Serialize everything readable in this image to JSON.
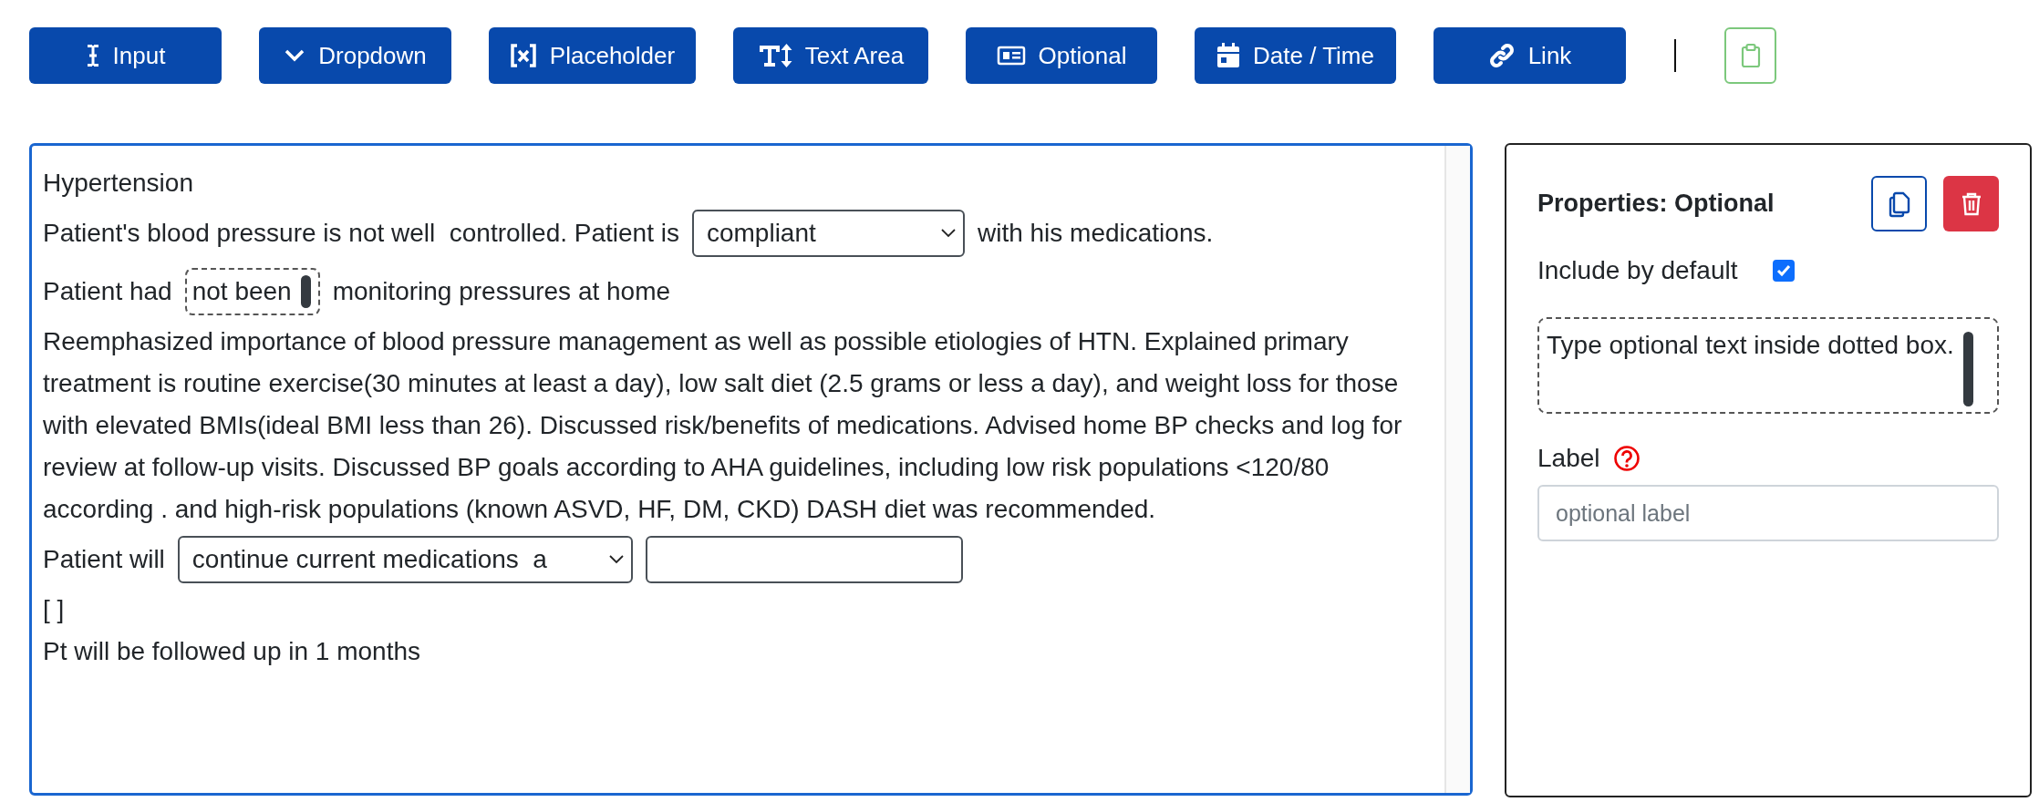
{
  "toolbar": {
    "buttons": [
      {
        "label": "Input"
      },
      {
        "label": "Dropdown"
      },
      {
        "label": "Placeholder"
      },
      {
        "label": "Text Area"
      },
      {
        "label": "Optional"
      },
      {
        "label": "Date / Time"
      },
      {
        "label": "Link"
      }
    ]
  },
  "editor": {
    "focused": true,
    "lines": [
      [
        {
          "kind": "text",
          "text": "Hypertension"
        }
      ],
      [
        {
          "kind": "text",
          "text": "Patient's blood pressure is not well  controlled. Patient is"
        },
        {
          "kind": "select",
          "value": "compliant"
        },
        {
          "kind": "text",
          "text": "with his medications."
        }
      ],
      [
        {
          "kind": "text",
          "text": "Patient had"
        },
        {
          "kind": "optional",
          "text": "not been"
        },
        {
          "kind": "text",
          "text": "monitoring pressures at home"
        }
      ],
      [
        {
          "kind": "paragraph",
          "text": "Reemphasized importance of blood pressure management as well as possible etiologies of HTN. Explained primary treatment is routine exercise(30 minutes at least a day), low salt diet (2.5 grams or less a day), and weight loss for those with elevated BMIs(ideal BMI less than 26). Discussed risk/benefits of medications. Advised home BP checks and log for review at follow-up visits. Discussed BP goals according to AHA guidelines, including low risk populations <120/80 according . and high-risk populations (known ASVD, HF, DM, CKD)  DASH diet was recommended."
        }
      ],
      [
        {
          "kind": "text",
          "text": "Patient will"
        },
        {
          "kind": "select",
          "value": "continue current medications  a"
        },
        {
          "kind": "input"
        }
      ],
      [
        {
          "kind": "text",
          "text": "[ ]"
        }
      ],
      [
        {
          "kind": "text",
          "text": "Pt will be followed up in 1 months"
        }
      ]
    ]
  },
  "properties": {
    "title": "Properties: Optional",
    "include_by_default": {
      "label": "Include by default",
      "checked": true
    },
    "optional_text": "Type optional text inside dotted box.",
    "label_field": {
      "label": "Label",
      "placeholder": "optional label"
    }
  }
}
